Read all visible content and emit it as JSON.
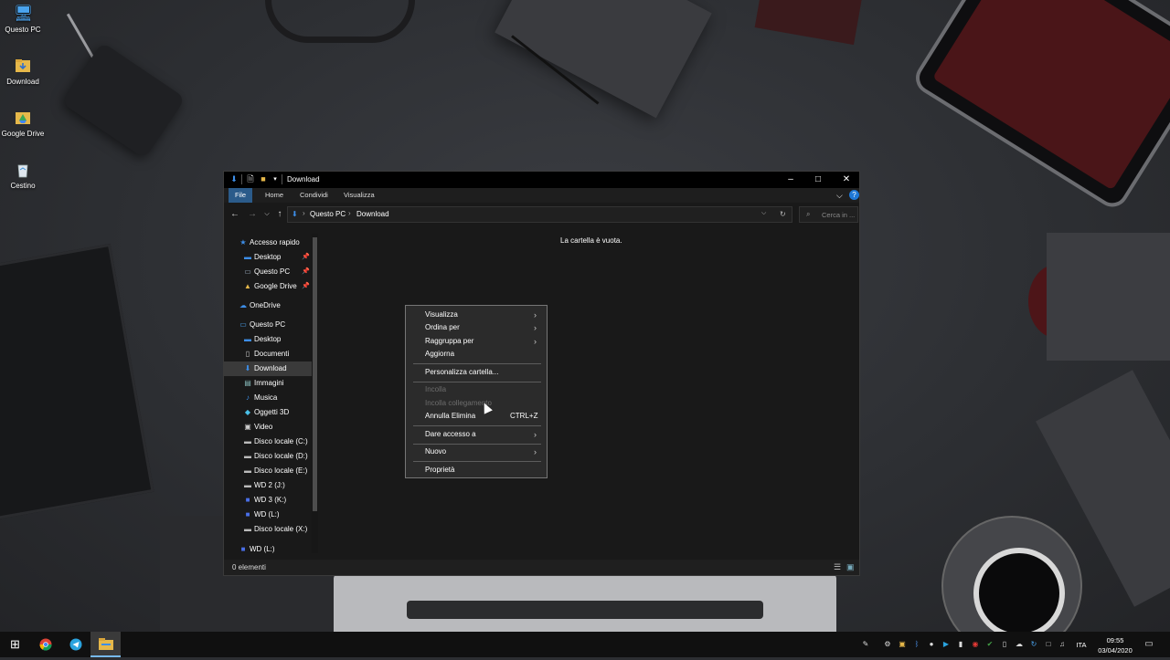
{
  "desktop": {
    "icons": [
      {
        "label": "Questo PC",
        "icon": "monitor-icon"
      },
      {
        "label": "Download",
        "icon": "folder-icon"
      },
      {
        "label": "Google Drive",
        "icon": "google-drive-icon"
      },
      {
        "label": "Cestino",
        "icon": "recycle-bin-icon"
      }
    ]
  },
  "window": {
    "title": "Download",
    "ribbon_tabs": [
      "File",
      "Home",
      "Condividi",
      "Visualizza"
    ],
    "breadcrumb": [
      "Questo PC",
      "Download"
    ],
    "search_placeholder": "Cerca in ...",
    "empty_message": "La cartella è vuota.",
    "status": "0 elementi",
    "nav": {
      "quick_access": "Accesso rapido",
      "quick_items": [
        "Desktop",
        "Questo PC",
        "Google Drive"
      ],
      "onedrive": "OneDrive",
      "this_pc": "Questo PC",
      "pc_items": [
        "Desktop",
        "Documenti",
        "Download",
        "Immagini",
        "Musica",
        "Oggetti 3D",
        "Video",
        "Disco locale (C:)",
        "Disco locale (D:)",
        "Disco locale (E:)",
        "WD 2 (J:)",
        "WD 3 (K:)",
        "WD (L:)",
        "Disco locale (X:)"
      ],
      "extra_drive": "WD (L:)",
      "selected": "Download"
    }
  },
  "context_menu": {
    "items": [
      {
        "label": "Visualizza",
        "submenu": true
      },
      {
        "label": "Ordina per",
        "submenu": true
      },
      {
        "label": "Raggruppa per",
        "submenu": true
      },
      {
        "label": "Aggiorna"
      },
      {
        "label": "Personalizza cartella..."
      },
      {
        "label": "Incolla",
        "disabled": true
      },
      {
        "label": "Incolla collegamento",
        "disabled": true
      },
      {
        "label": "Annulla Elimina",
        "shortcut": "CTRL+Z"
      },
      {
        "label": "Dare accesso a",
        "submenu": true
      },
      {
        "label": "Nuovo",
        "submenu": true
      },
      {
        "label": "Proprietà"
      }
    ]
  },
  "taskbar": {
    "language": "ITA",
    "time": "09:55",
    "date": "03/04/2020"
  },
  "colors": {
    "accent": "#2b5b8a",
    "window_bg": "#191919",
    "taskbar_bg": "#101010"
  }
}
